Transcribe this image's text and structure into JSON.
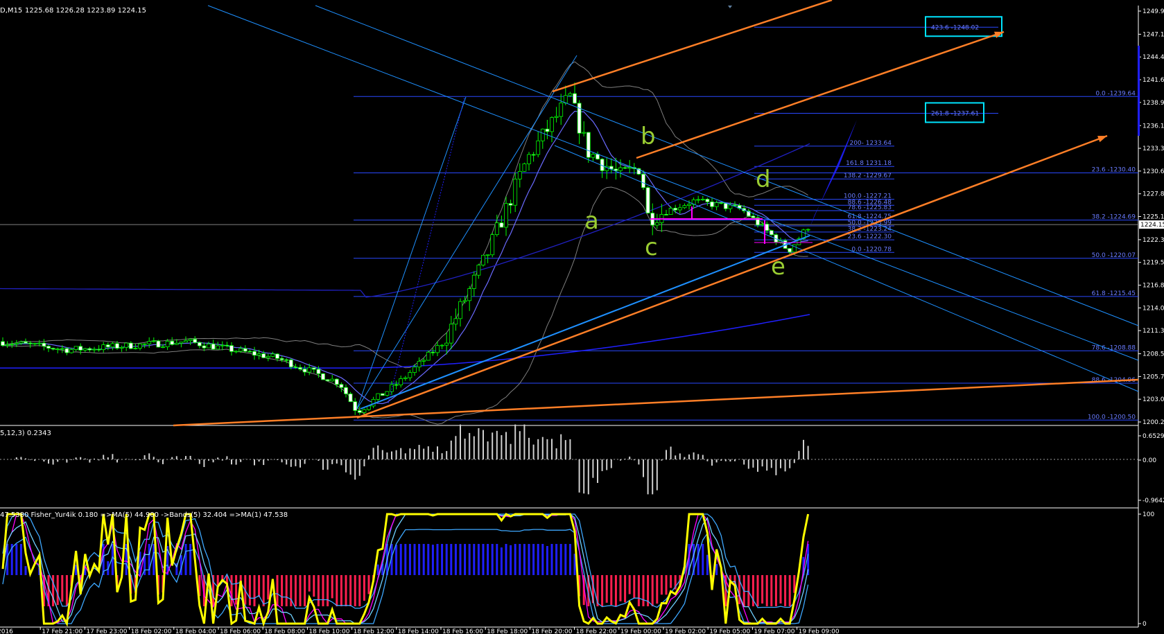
{
  "header": {
    "symbol_text": "D,M15",
    "ohlc_text": "1225.68 1226.28 1223.89 1224.15"
  },
  "price_axis": {
    "ticks": [
      "1249.97",
      "1247.17",
      "1244.42",
      "1241.67",
      "1238.92",
      "1236.12",
      "1233.37",
      "1230.62",
      "1227.87",
      "1225.12",
      "1222.32",
      "1219.57",
      "1216.82",
      "1214.07",
      "1211.32",
      "1208.52",
      "1205.77",
      "1203.02",
      "1200.27"
    ],
    "current_price": "1224.15"
  },
  "fib_levels": {
    "right": [
      "0.0 -1239.64",
      "23.6 -1230.40",
      "38.2 -1224.69",
      "50.0 -1220.07",
      "61.8 -1215.45",
      "78.6 -1208.88",
      "88.6 -1204.96",
      "100.0 -1200.50"
    ],
    "projection": [
      "423.6 -1248.02",
      "261.8 -1237.61",
      "200- 1233.64",
      "161.8 1231.18",
      "138.2 -1229.67",
      "100.0 -1227.21",
      "88.6 -1226.48",
      "78.6 -1225.83",
      "61.8 -1224.75",
      "50.0 -1223.99",
      "38.2 -1223.24",
      "23.6 -1222.30",
      "0.0 -1220.78"
    ],
    "boxed": [
      "423.6 -1248.02",
      "261.8 -1237.61"
    ]
  },
  "wave_labels": [
    "a",
    "b",
    "c",
    "d",
    "e"
  ],
  "indicator1": {
    "label": "5,12,3) 0.2343",
    "ticks": [
      "0.6529",
      "0.00",
      "-0.9642"
    ]
  },
  "indicator2": {
    "label": "47.5380  Fisher_Yur4ik 0.180  =>MA(5) 44.900  ->Bands(5) 32.404  =>MA(1) 47.538",
    "ticks": [
      "100",
      "0"
    ]
  },
  "time_axis": [
    "2016",
    "17 Feb 21:00",
    "17 Feb 23:00",
    "18 Feb 02:00",
    "18 Feb 04:00",
    "18 Feb 06:00",
    "18 Feb 08:00",
    "18 Feb 10:00",
    "18 Feb 12:00",
    "18 Feb 14:00",
    "18 Feb 16:00",
    "18 Feb 18:00",
    "18 Feb 20:00",
    "18 Feb 22:00",
    "19 Feb 00:00",
    "19 Feb 02:00",
    "19 Feb 05:00",
    "19 Feb 07:00",
    "19 Feb 09:00"
  ],
  "colors": {
    "background": "#000000",
    "candle_up": "#00ff00",
    "candle_border": "#00ff00",
    "fib_line": "#2a48ff",
    "fib_text": "#6a7cff",
    "channel": "#1e90ff",
    "orange_fan": "#ff7f27",
    "band": "#7f7f7f",
    "wave_label": "#9acd32",
    "box": "#00e5ff",
    "fisher_yellow": "#ffff00",
    "hist_pos": "#1f1fff",
    "hist_neg": "#ff1f4f",
    "axis_text": "#c0c0c0"
  },
  "chart_data": {
    "type": "candlestick",
    "instrument_timeframe": "D,M15",
    "last_ohlc": {
      "open": 1225.68,
      "high": 1226.28,
      "low": 1223.89,
      "close": 1224.15
    },
    "ylim": [
      1200.27,
      1249.97
    ],
    "waypoints": [
      {
        "time": "17 Feb 19:00",
        "price": 1210
      },
      {
        "time": "17 Feb 23:00",
        "price": 1209
      },
      {
        "time": "18 Feb 04:00",
        "price": 1210
      },
      {
        "time": "18 Feb 08:00",
        "price": 1208
      },
      {
        "time": "18 Feb 11:00",
        "price": 1205
      },
      {
        "time": "18 Feb 12:00",
        "price": 1201.5
      },
      {
        "time": "18 Feb 14:00",
        "price": 1205
      },
      {
        "time": "18 Feb 16:00",
        "price": 1210
      },
      {
        "time": "18 Feb 18:00",
        "price": 1220
      },
      {
        "time": "18 Feb 20:00",
        "price": 1232
      },
      {
        "time": "18 Feb 22:00",
        "price": 1239.6
      },
      {
        "time": "18 Feb 23:00",
        "price": 1233
      },
      {
        "time": "19 Feb 00:00",
        "price": 1230
      },
      {
        "time": "19 Feb 01:00",
        "price": 1231.2
      },
      {
        "time": "19 Feb 02:00",
        "price": 1225
      },
      {
        "time": "19 Feb 04:00",
        "price": 1227
      },
      {
        "time": "19 Feb 06:00",
        "price": 1226
      },
      {
        "time": "19 Feb 07:30",
        "price": 1221
      },
      {
        "time": "19 Feb 09:00",
        "price": 1224.15
      }
    ]
  }
}
